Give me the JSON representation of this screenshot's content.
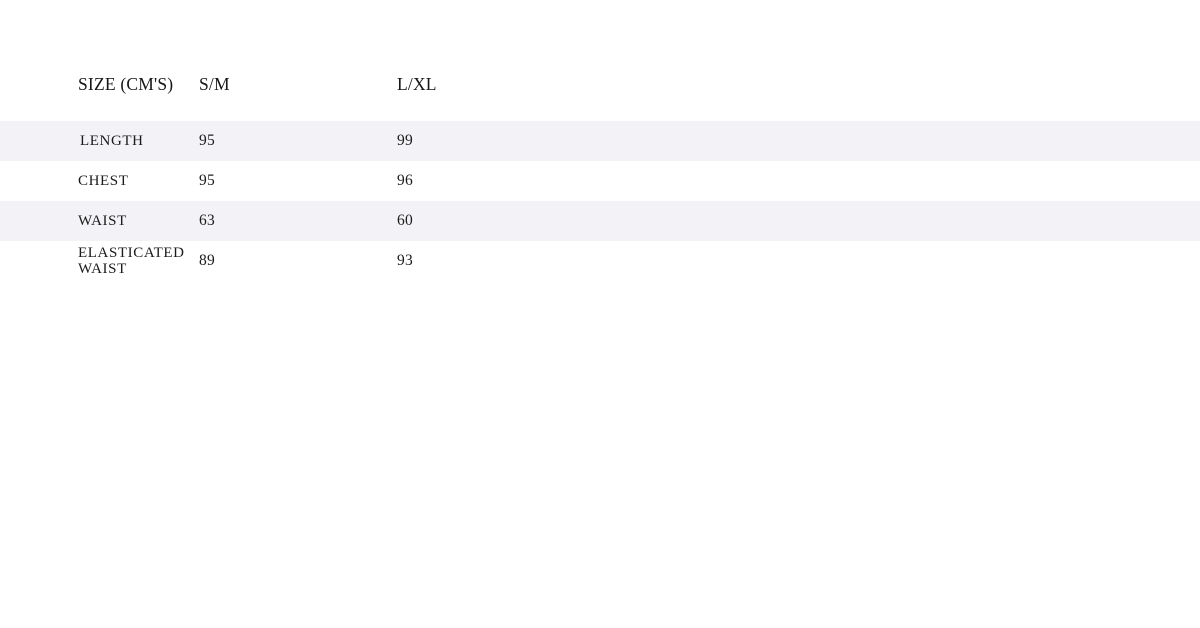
{
  "table": {
    "columns": [
      {
        "key": "label",
        "header": "SIZE (CM'S)"
      },
      {
        "key": "sm",
        "header": "S/M"
      },
      {
        "key": "lxl",
        "header": "L/XL"
      }
    ],
    "rows": [
      {
        "label": "LENGTH",
        "sm": "95",
        "lxl": "99"
      },
      {
        "label": "CHEST",
        "sm": "95",
        "lxl": "96"
      },
      {
        "label": "WAIST",
        "sm": "63",
        "lxl": "60"
      },
      {
        "label": "ELASTICATED WAIST",
        "sm": "89",
        "lxl": "93"
      }
    ]
  },
  "colors": {
    "page_background": "#ffffff",
    "stripe_background": "#f3f2f6",
    "text": "#1a1a1a"
  }
}
